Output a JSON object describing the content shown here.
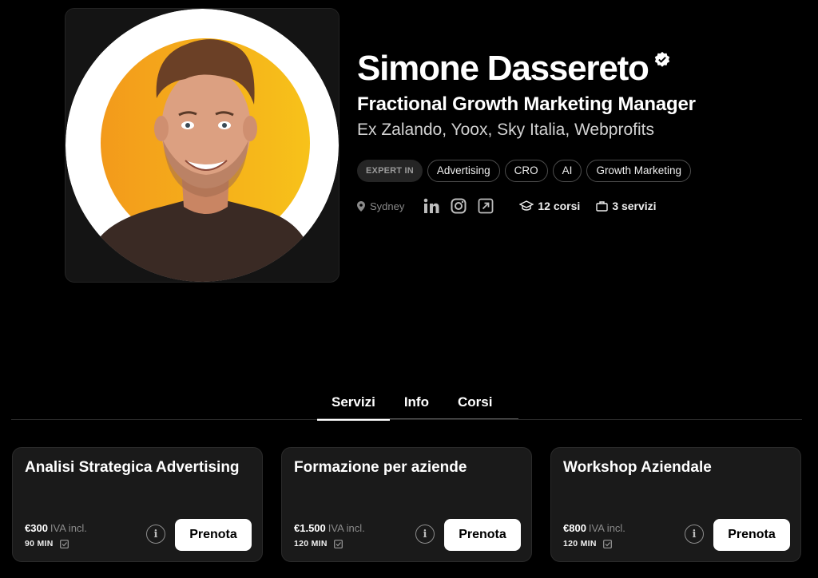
{
  "profile": {
    "name": "Simone Dassereto",
    "headline": "Fractional Growth Marketing Manager",
    "subline": "Ex Zalando, Yoox, Sky Italia, Webprofits",
    "expertise_label": "EXPERT IN",
    "tags": [
      "Advertising",
      "CRO",
      "AI",
      "Growth Marketing"
    ],
    "location": "Sydney",
    "courses_count": "12 corsi",
    "services_count": "3 servizi",
    "icons": {
      "verified": "verified-badge-icon",
      "location": "location-pin-icon",
      "linkedin": "linkedin-icon",
      "instagram": "instagram-icon",
      "website": "external-link-icon",
      "courses": "graduation-cap-icon",
      "services": "briefcase-icon"
    }
  },
  "tabs": [
    "Servizi",
    "Info",
    "Corsi"
  ],
  "active_tab": "Servizi",
  "services": [
    {
      "title": "Analisi Strategica Advertising",
      "price": "€300",
      "vat": "IVA incl.",
      "duration": "90 MIN",
      "button": "Prenota"
    },
    {
      "title": "Formazione per aziende",
      "price": "€1.500",
      "vat": "IVA incl.",
      "duration": "120 MIN",
      "button": "Prenota"
    },
    {
      "title": "Workshop Aziendale",
      "price": "€800",
      "vat": "IVA incl.",
      "duration": "120 MIN",
      "button": "Prenota"
    }
  ],
  "colors": {
    "background": "#000000",
    "card": "#1a1a1a",
    "avatar_ring": "#ffffff",
    "avatar_fill": "#f5a623"
  }
}
